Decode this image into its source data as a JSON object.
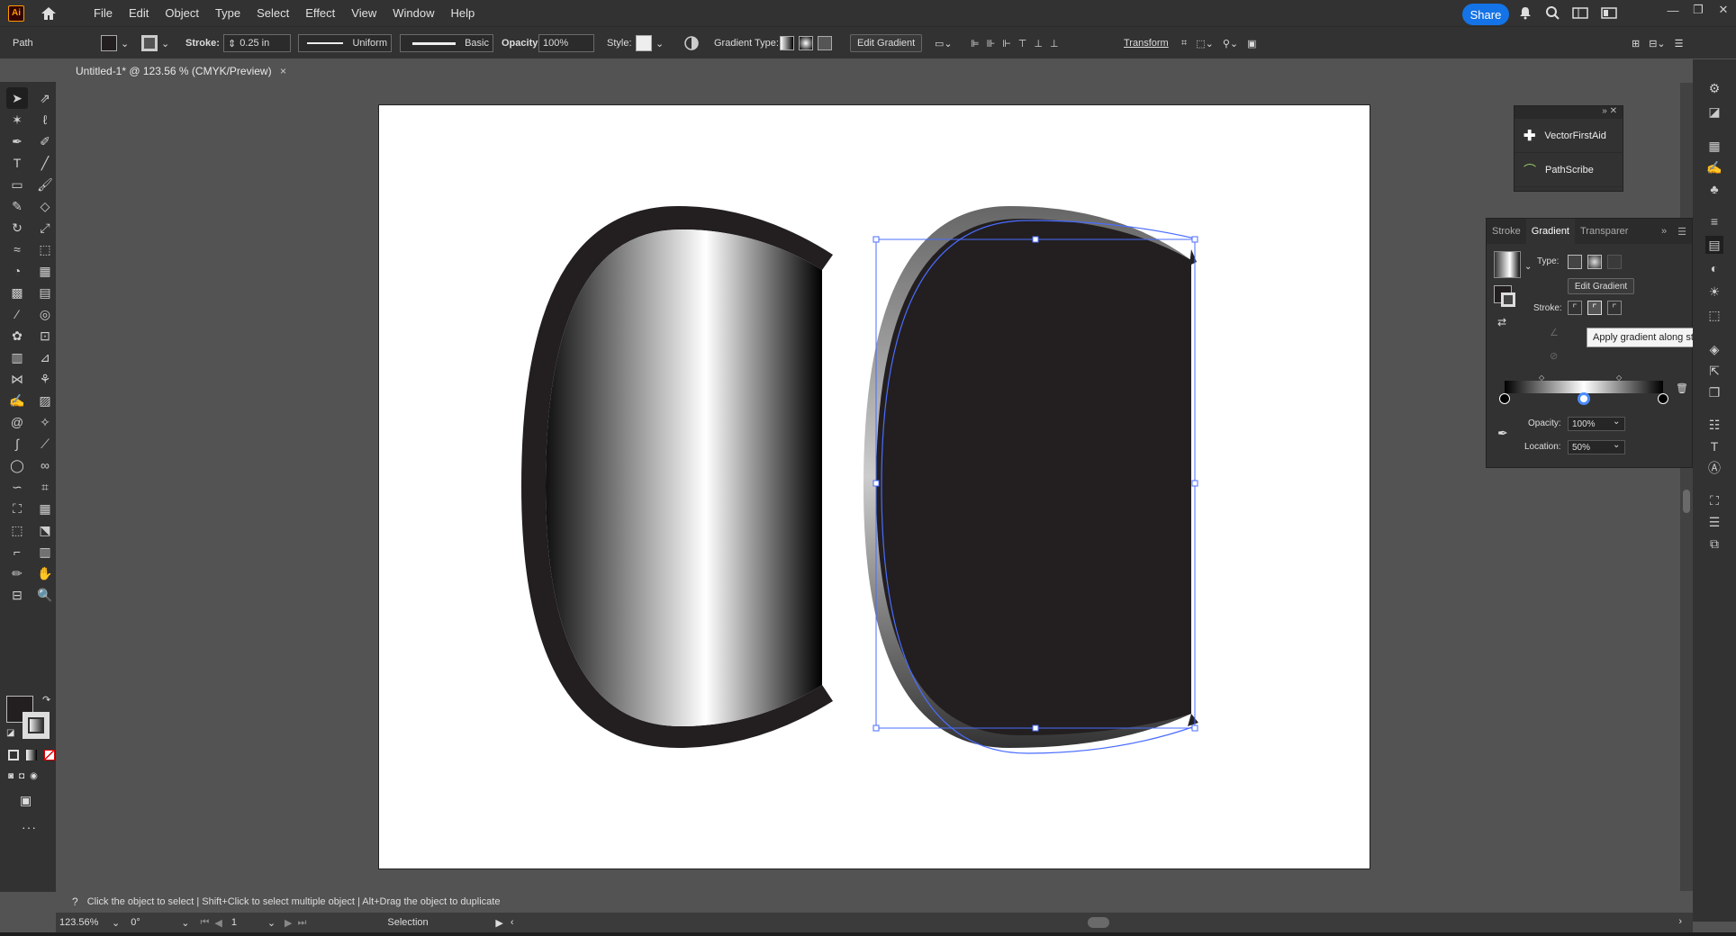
{
  "app": {
    "logo": "Ai"
  },
  "menu": [
    "File",
    "Edit",
    "Object",
    "Type",
    "Select",
    "Effect",
    "View",
    "Window",
    "Help"
  ],
  "topbar": {
    "share_label": "Share"
  },
  "control": {
    "selection_type": "Path",
    "stroke_label": "Stroke:",
    "stroke_weight": "0.25 in",
    "profile": "Uniform",
    "brush": "Basic",
    "opacity_label": "Opacity:",
    "opacity_value": "100%",
    "style_label": "Style:",
    "gradient_type_label": "Gradient Type:",
    "edit_gradient_label": "Edit Gradient",
    "transform_label": "Transform"
  },
  "document": {
    "tab_title": "Untitled-1* @ 123.56 % (CMYK/Preview)",
    "close": "×"
  },
  "plugins": {
    "items": [
      "VectorFirstAid",
      "PathScribe"
    ]
  },
  "gradient_panel": {
    "tabs": [
      "Stroke",
      "Gradient",
      "Transparer"
    ],
    "active_tab": "Gradient",
    "type_label": "Type:",
    "edit_gradient_label": "Edit Gradient",
    "stroke_label": "Stroke:",
    "opacity_label": "Opacity:",
    "opacity_value": "100%",
    "location_label": "Location:",
    "location_value": "50%",
    "stop_location": 0.5
  },
  "tooltip": "Apply gradient along stroke",
  "status": {
    "hint": "Click the object to select  |  Shift+Click to select multiple object  |  Alt+Drag the object to duplicate",
    "zoom": "123.56%",
    "rotation": "0°",
    "artboard_num": "1",
    "tool_name": "Selection"
  },
  "colors": {
    "accent": "#1473e6",
    "selection": "#4a6cff",
    "shape_dark": "#231f20"
  }
}
